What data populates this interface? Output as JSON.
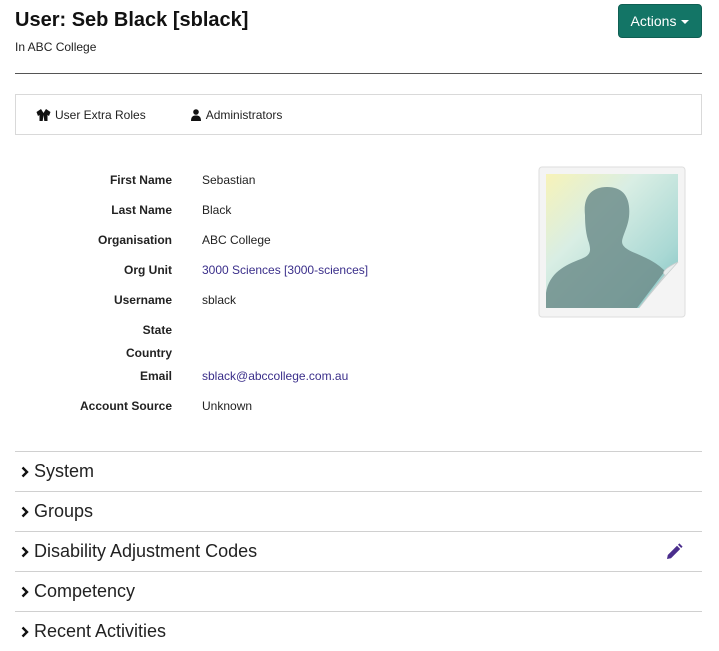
{
  "header": {
    "title": "User: Seb Black [sblack]",
    "subtitle": "In ABC College",
    "actions_label": "Actions"
  },
  "tabs": [
    {
      "label": "User Extra Roles",
      "icon": "jacket-icon"
    },
    {
      "label": "Administrators",
      "icon": "person-icon"
    }
  ],
  "details": {
    "first_name": {
      "label": "First Name",
      "value": "Sebastian"
    },
    "last_name": {
      "label": "Last Name",
      "value": "Black"
    },
    "organisation": {
      "label": "Organisation",
      "value": "ABC College"
    },
    "org_unit": {
      "label": "Org Unit",
      "value": "3000 Sciences [3000-sciences]"
    },
    "username": {
      "label": "Username",
      "value": "sblack"
    },
    "state": {
      "label": "State",
      "value": ""
    },
    "country": {
      "label": "Country",
      "value": ""
    },
    "email": {
      "label": "Email",
      "value": "sblack@abccollege.com.au"
    },
    "account_source": {
      "label": "Account Source",
      "value": "Unknown"
    }
  },
  "sections": [
    {
      "label": "System"
    },
    {
      "label": "Groups"
    },
    {
      "label": "Disability Adjustment Codes"
    },
    {
      "label": "Competency"
    },
    {
      "label": "Recent Activities"
    }
  ],
  "colors": {
    "primary_button": "#137566",
    "link": "#3a2e8a",
    "edit_icon": "#4a2d8c"
  }
}
